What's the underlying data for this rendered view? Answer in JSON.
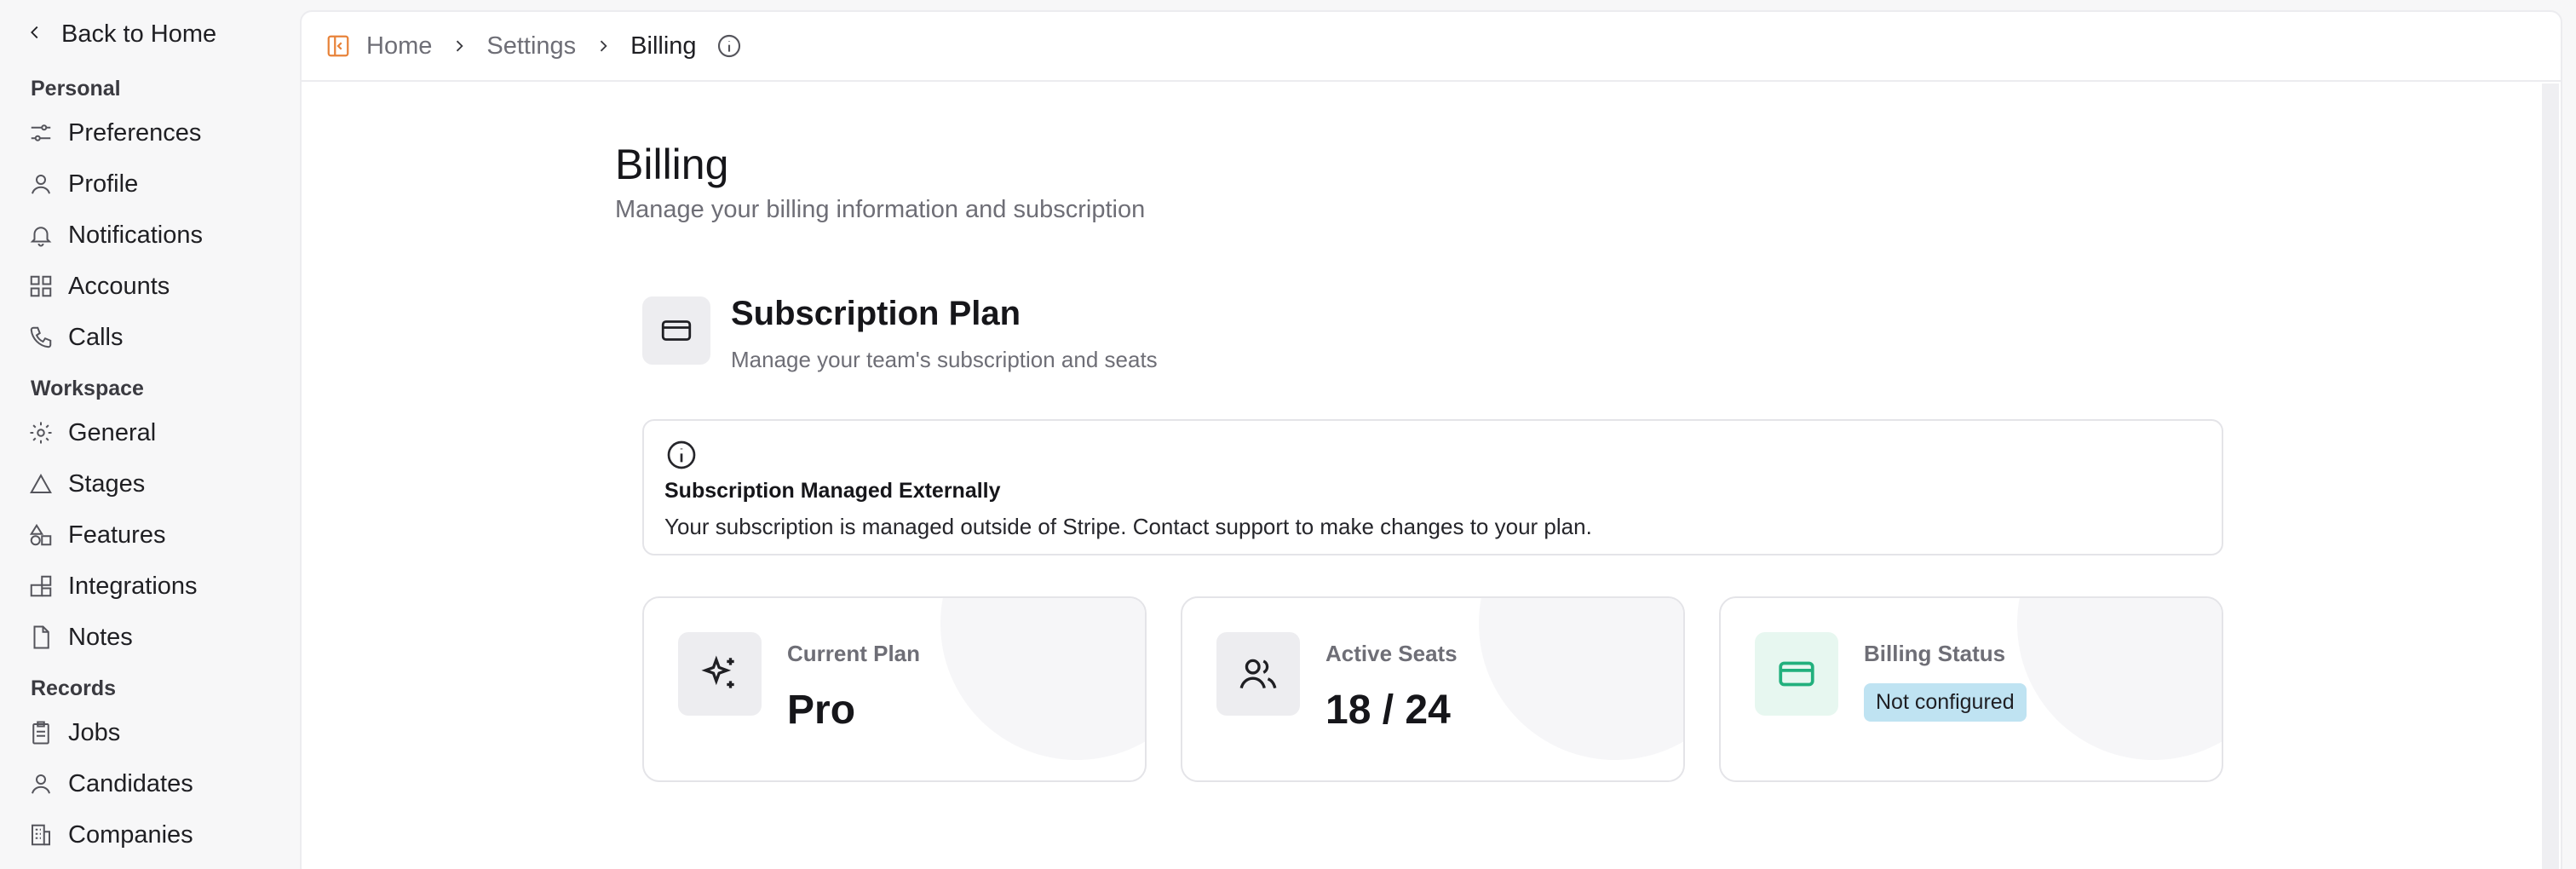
{
  "sidebar": {
    "back_label": "Back to Home",
    "sections": {
      "personal": "Personal",
      "workspace": "Workspace",
      "records": "Records"
    },
    "items": [
      {
        "label": "Preferences",
        "icon": "sliders-icon"
      },
      {
        "label": "Profile",
        "icon": "user-icon"
      },
      {
        "label": "Notifications",
        "icon": "bell-icon"
      },
      {
        "label": "Accounts",
        "icon": "grid-icon"
      },
      {
        "label": "Calls",
        "icon": "phone-icon"
      },
      {
        "label": "General",
        "icon": "gear-icon"
      },
      {
        "label": "Stages",
        "icon": "triangle-icon"
      },
      {
        "label": "Features",
        "icon": "shapes-icon"
      },
      {
        "label": "Integrations",
        "icon": "blocks-icon"
      },
      {
        "label": "Notes",
        "icon": "file-icon"
      },
      {
        "label": "Jobs",
        "icon": "clipboard-icon"
      },
      {
        "label": "Candidates",
        "icon": "user-icon"
      },
      {
        "label": "Companies",
        "icon": "building-icon"
      }
    ]
  },
  "breadcrumb": {
    "home": "Home",
    "settings": "Settings",
    "current": "Billing"
  },
  "page": {
    "title": "Billing",
    "subtitle": "Manage your billing information and subscription"
  },
  "plan": {
    "title": "Subscription Plan",
    "subtitle": "Manage your team's subscription and seats"
  },
  "notice": {
    "title": "Subscription Managed Externally",
    "text": "Your subscription is managed outside of Stripe. Contact support to make changes to your plan."
  },
  "cards": {
    "current_plan": {
      "label": "Current Plan",
      "value": "Pro",
      "icon": "sparkles-icon"
    },
    "active_seats": {
      "label": "Active Seats",
      "value": "18 / 24",
      "icon": "users-icon"
    },
    "billing_status": {
      "label": "Billing Status",
      "value": "Not configured",
      "icon": "credit-card-icon"
    }
  },
  "colors": {
    "accent_orange": "#e8833a",
    "status_badge_bg": "#bfe3f2",
    "billing_green": "#22b07d"
  }
}
